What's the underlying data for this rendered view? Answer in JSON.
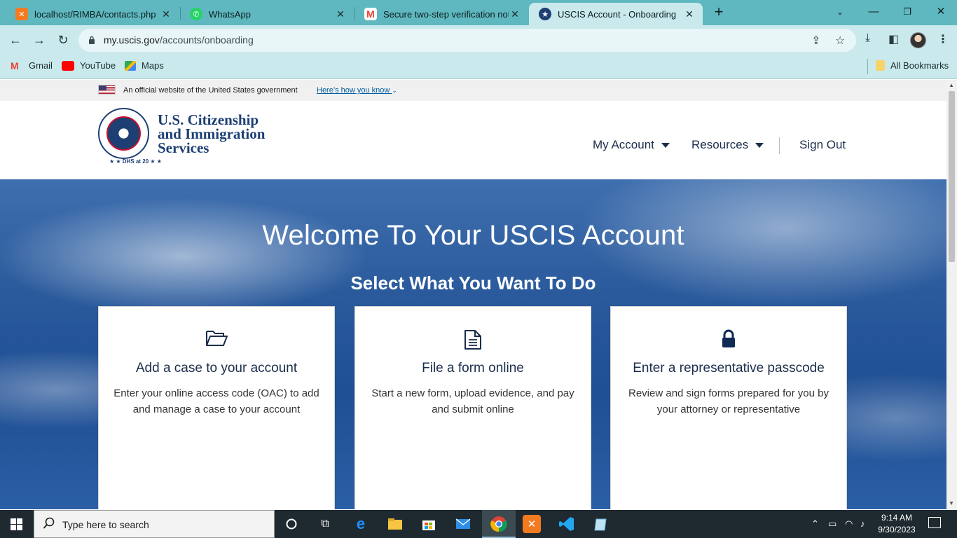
{
  "browser": {
    "tabs": [
      {
        "title": "localhost/RIMBA/contacts.php",
        "favicon": "xampp-icon",
        "active": false
      },
      {
        "title": "WhatsApp",
        "favicon": "whatsapp-icon",
        "active": false
      },
      {
        "title": "Secure two-step verification not",
        "favicon": "gmail-icon",
        "active": false
      },
      {
        "title": "USCIS Account - Onboarding",
        "favicon": "dhs-seal-icon",
        "active": true
      }
    ],
    "new_tab": "+",
    "close": "✕",
    "address": {
      "domain": "my.uscis.gov",
      "path": "/accounts/onboarding"
    },
    "bookmarks": [
      {
        "label": "Gmail",
        "icon": "gmail-icon"
      },
      {
        "label": "YouTube",
        "icon": "youtube-icon"
      },
      {
        "label": "Maps",
        "icon": "maps-icon"
      }
    ],
    "all_bookmarks": "All Bookmarks"
  },
  "gov_banner": {
    "text": "An official website of the United States government",
    "link": "Here’s how you know"
  },
  "header": {
    "agency_line1": "U.S. Citizenship",
    "agency_line2": "and Immigration",
    "agency_line3": "Services",
    "seal_caption": "★ ★ DHS at 20 ★ ★",
    "nav": {
      "my_account": "My Account",
      "resources": "Resources",
      "sign_out": "Sign Out"
    }
  },
  "hero": {
    "title": "Welcome To Your USCIS Account",
    "subtitle": "Select What You Want To Do",
    "cards": [
      {
        "icon": "folder-open-icon",
        "title": "Add a case to your account",
        "desc": "Enter your online access code (OAC) to add and manage a case to your account"
      },
      {
        "icon": "document-icon",
        "title": "File a form online",
        "desc": "Start a new form, upload evidence, and pay and submit online"
      },
      {
        "icon": "lock-icon",
        "title": "Enter a representative passcode",
        "desc": "Review and sign forms prepared for you by your attorney or representative"
      }
    ]
  },
  "taskbar": {
    "search_placeholder": "Type here to search",
    "time": "9:14 AM",
    "date": "9/30/2023"
  },
  "colors": {
    "tab_strip": "#5fb8bf",
    "toolbar": "#c9e9ed",
    "uscis_navy": "#1d3f74",
    "link": "#005ea2"
  }
}
